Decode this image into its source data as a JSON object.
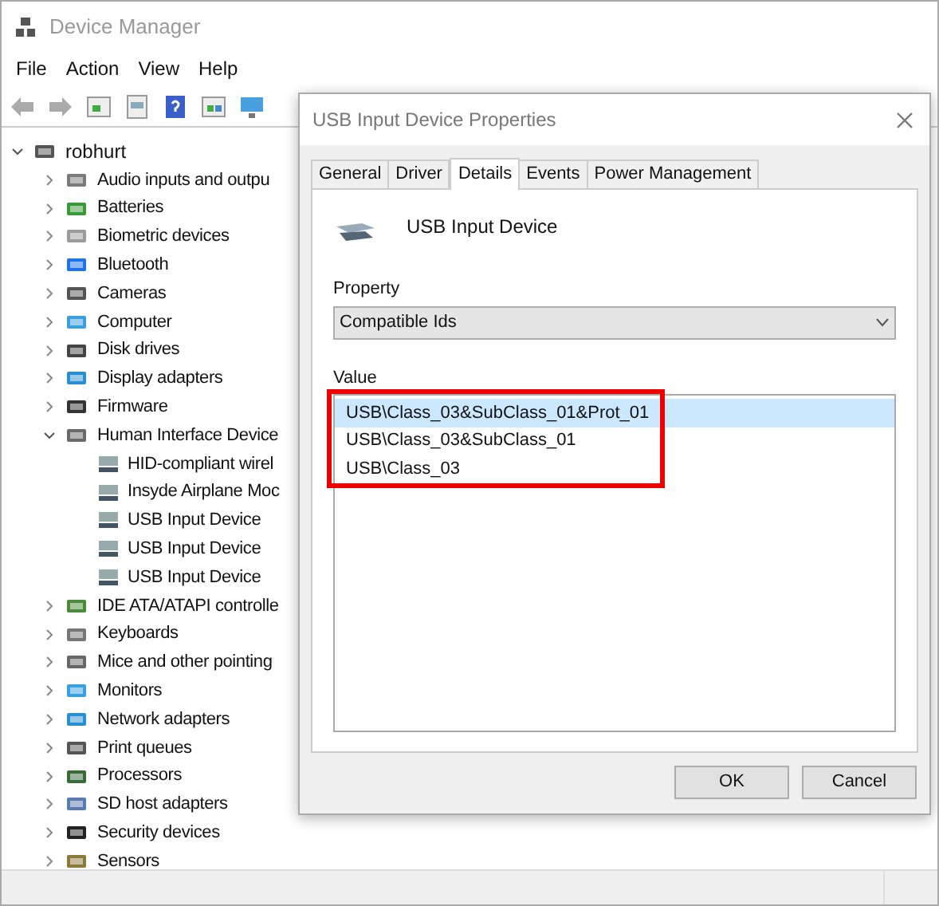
{
  "window": {
    "title": "Device Manager"
  },
  "menu": [
    "File",
    "Action",
    "View",
    "Help"
  ],
  "tree": {
    "label": "robhurt",
    "expanded": true,
    "children": [
      {
        "label": "Audio inputs and outpu",
        "expanded": false
      },
      {
        "label": "Batteries",
        "expanded": false
      },
      {
        "label": "Biometric devices",
        "expanded": false
      },
      {
        "label": "Bluetooth",
        "expanded": false
      },
      {
        "label": "Cameras",
        "expanded": false
      },
      {
        "label": "Computer",
        "expanded": false
      },
      {
        "label": "Disk drives",
        "expanded": false
      },
      {
        "label": "Display adapters",
        "expanded": false
      },
      {
        "label": "Firmware",
        "expanded": false
      },
      {
        "label": "Human Interface Device",
        "expanded": true,
        "children": [
          {
            "label": "HID-compliant wirel"
          },
          {
            "label": "Insyde Airplane Moc"
          },
          {
            "label": "USB Input Device"
          },
          {
            "label": "USB Input Device"
          },
          {
            "label": "USB Input Device"
          }
        ]
      },
      {
        "label": "IDE ATA/ATAPI controlle",
        "expanded": false
      },
      {
        "label": "Keyboards",
        "expanded": false
      },
      {
        "label": "Mice and other pointing",
        "expanded": false
      },
      {
        "label": "Monitors",
        "expanded": false
      },
      {
        "label": "Network adapters",
        "expanded": false
      },
      {
        "label": "Print queues",
        "expanded": false
      },
      {
        "label": "Processors",
        "expanded": false
      },
      {
        "label": "SD host adapters",
        "expanded": false
      },
      {
        "label": "Security devices",
        "expanded": false
      },
      {
        "label": "Sensors",
        "expanded": false
      }
    ]
  },
  "dialog": {
    "title": "USB Input Device Properties",
    "tabs": [
      {
        "label": "General",
        "selected": false
      },
      {
        "label": "Driver",
        "selected": false
      },
      {
        "label": "Details",
        "selected": true
      },
      {
        "label": "Events",
        "selected": false
      },
      {
        "label": "Power Management",
        "selected": false
      }
    ],
    "device_name": "USB Input Device",
    "property_label": "Property",
    "property_value": "Compatible Ids",
    "value_label": "Value",
    "values": [
      {
        "text": "USB\\Class_03&SubClass_01&Prot_01",
        "selected": true
      },
      {
        "text": "USB\\Class_03&SubClass_01",
        "selected": false
      },
      {
        "text": "USB\\Class_03",
        "selected": false
      }
    ],
    "buttons": [
      "OK",
      "Cancel"
    ]
  }
}
